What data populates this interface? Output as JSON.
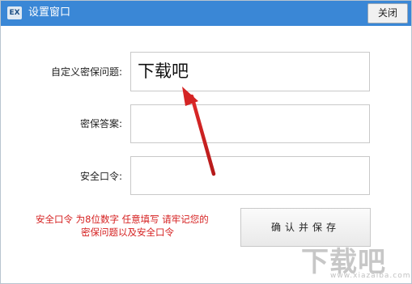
{
  "window": {
    "title": "设置窗口",
    "app_icon": "EX",
    "close_label": "关闭"
  },
  "form": {
    "question_label": "自定义密保问题:",
    "question_value": "下载吧",
    "answer_label": "密保答案:",
    "answer_value": "",
    "password_label": "安全口令:",
    "password_value": ""
  },
  "hint": {
    "line1": "安全口令 为8位数字 任意填写 请牢记您的",
    "line2": "密保问题以及安全口令"
  },
  "buttons": {
    "confirm_label": "确认并保存"
  },
  "watermark": {
    "text": "下载吧",
    "url": "www.xiazaiba.com"
  },
  "colors": {
    "titlebar": "#3a87d6",
    "hint_text": "#d51f1f",
    "arrow": "#d42424"
  }
}
